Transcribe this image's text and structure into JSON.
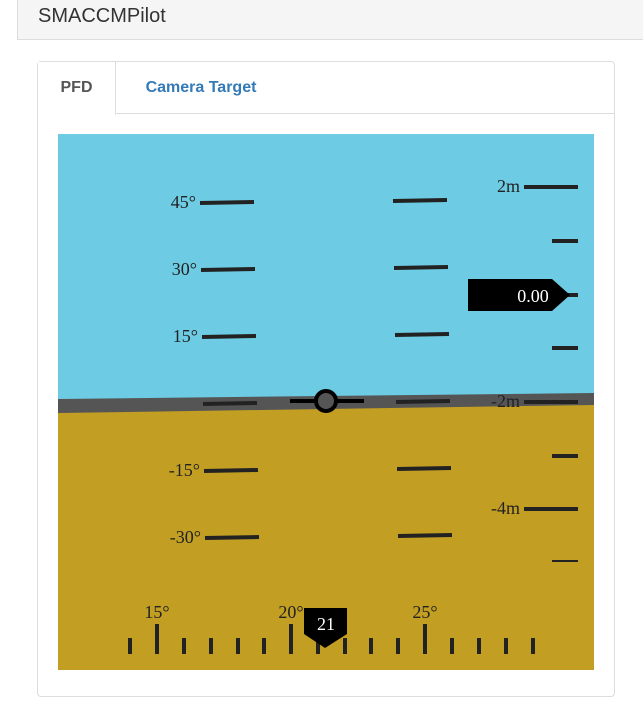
{
  "header": {
    "title": "SMACCMPilot"
  },
  "tabs": [
    {
      "label": "PFD",
      "active": true
    },
    {
      "label": "Camera Target",
      "active": false
    }
  ],
  "pfd": {
    "colors": {
      "sky": "#6ecbe4",
      "ground": "#c29e22",
      "horizon": "#555555",
      "marks": "#222222",
      "pointer": "#000000",
      "pointer_text": "#ffffff"
    },
    "pitch_labels": [
      "45°",
      "30°",
      "15°",
      "-15°",
      "-30°"
    ],
    "altitude_labels": [
      "2m",
      "-2m",
      "-4m"
    ],
    "altitude_readout": "0.00",
    "heading_labels": [
      "15°",
      "20°",
      "25°"
    ],
    "heading_readout": "21",
    "roll_deg": -1.5
  }
}
